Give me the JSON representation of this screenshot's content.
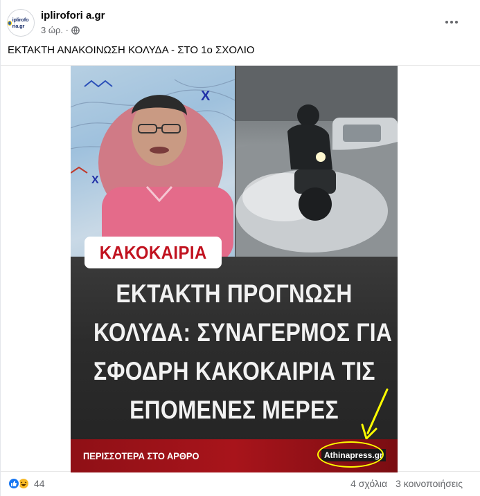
{
  "post": {
    "page_name": "iplirofori a.gr",
    "avatar_text": "iplirofo ria.gr",
    "time": "3 ώρ. ·",
    "privacy_icon": "globe-icon",
    "text": "ΕΚΤΑΚΤΗ ΑΝΑΚΟΙΝΩΣΗ ΚΟΛΥΔΑ - ΣΤΟ 1ο ΣΧΟΛΙΟ"
  },
  "image": {
    "tag": "ΚΑΚΟΚΑΙΡΙΑ",
    "headline_lines": [
      "ΕΚΤΑΚΤΗ ΠΡΟΓΝΩΣΗ",
      "ΚΟΛΥΔΑ: ΣΥΝΑΓΕΡΜΟΣ ΓΙΑ",
      "ΣΦΟΔΡΗ ΚΑΚΟΚΑΙΡΙΑ ΤΙΣ",
      "ΕΠΟΜΕΝΕΣ ΜΕΡΕΣ"
    ],
    "cta": "ΠΕΡΙΣΣΟΤΕΡΑ ΣΤΟ ΑΡΘΡΟ",
    "source": "Athinapress.gr",
    "highlight_color": "#ffff00"
  },
  "footer": {
    "reaction_icons": [
      "like-icon",
      "haha-icon"
    ],
    "reaction_count": "44",
    "comments": "4 σχόλια",
    "shares": "3 κοινοποιήσεις"
  },
  "colors": {
    "accent": "#1877f2",
    "tag_red": "#c1121f",
    "cta_bar": "#a8141b"
  }
}
